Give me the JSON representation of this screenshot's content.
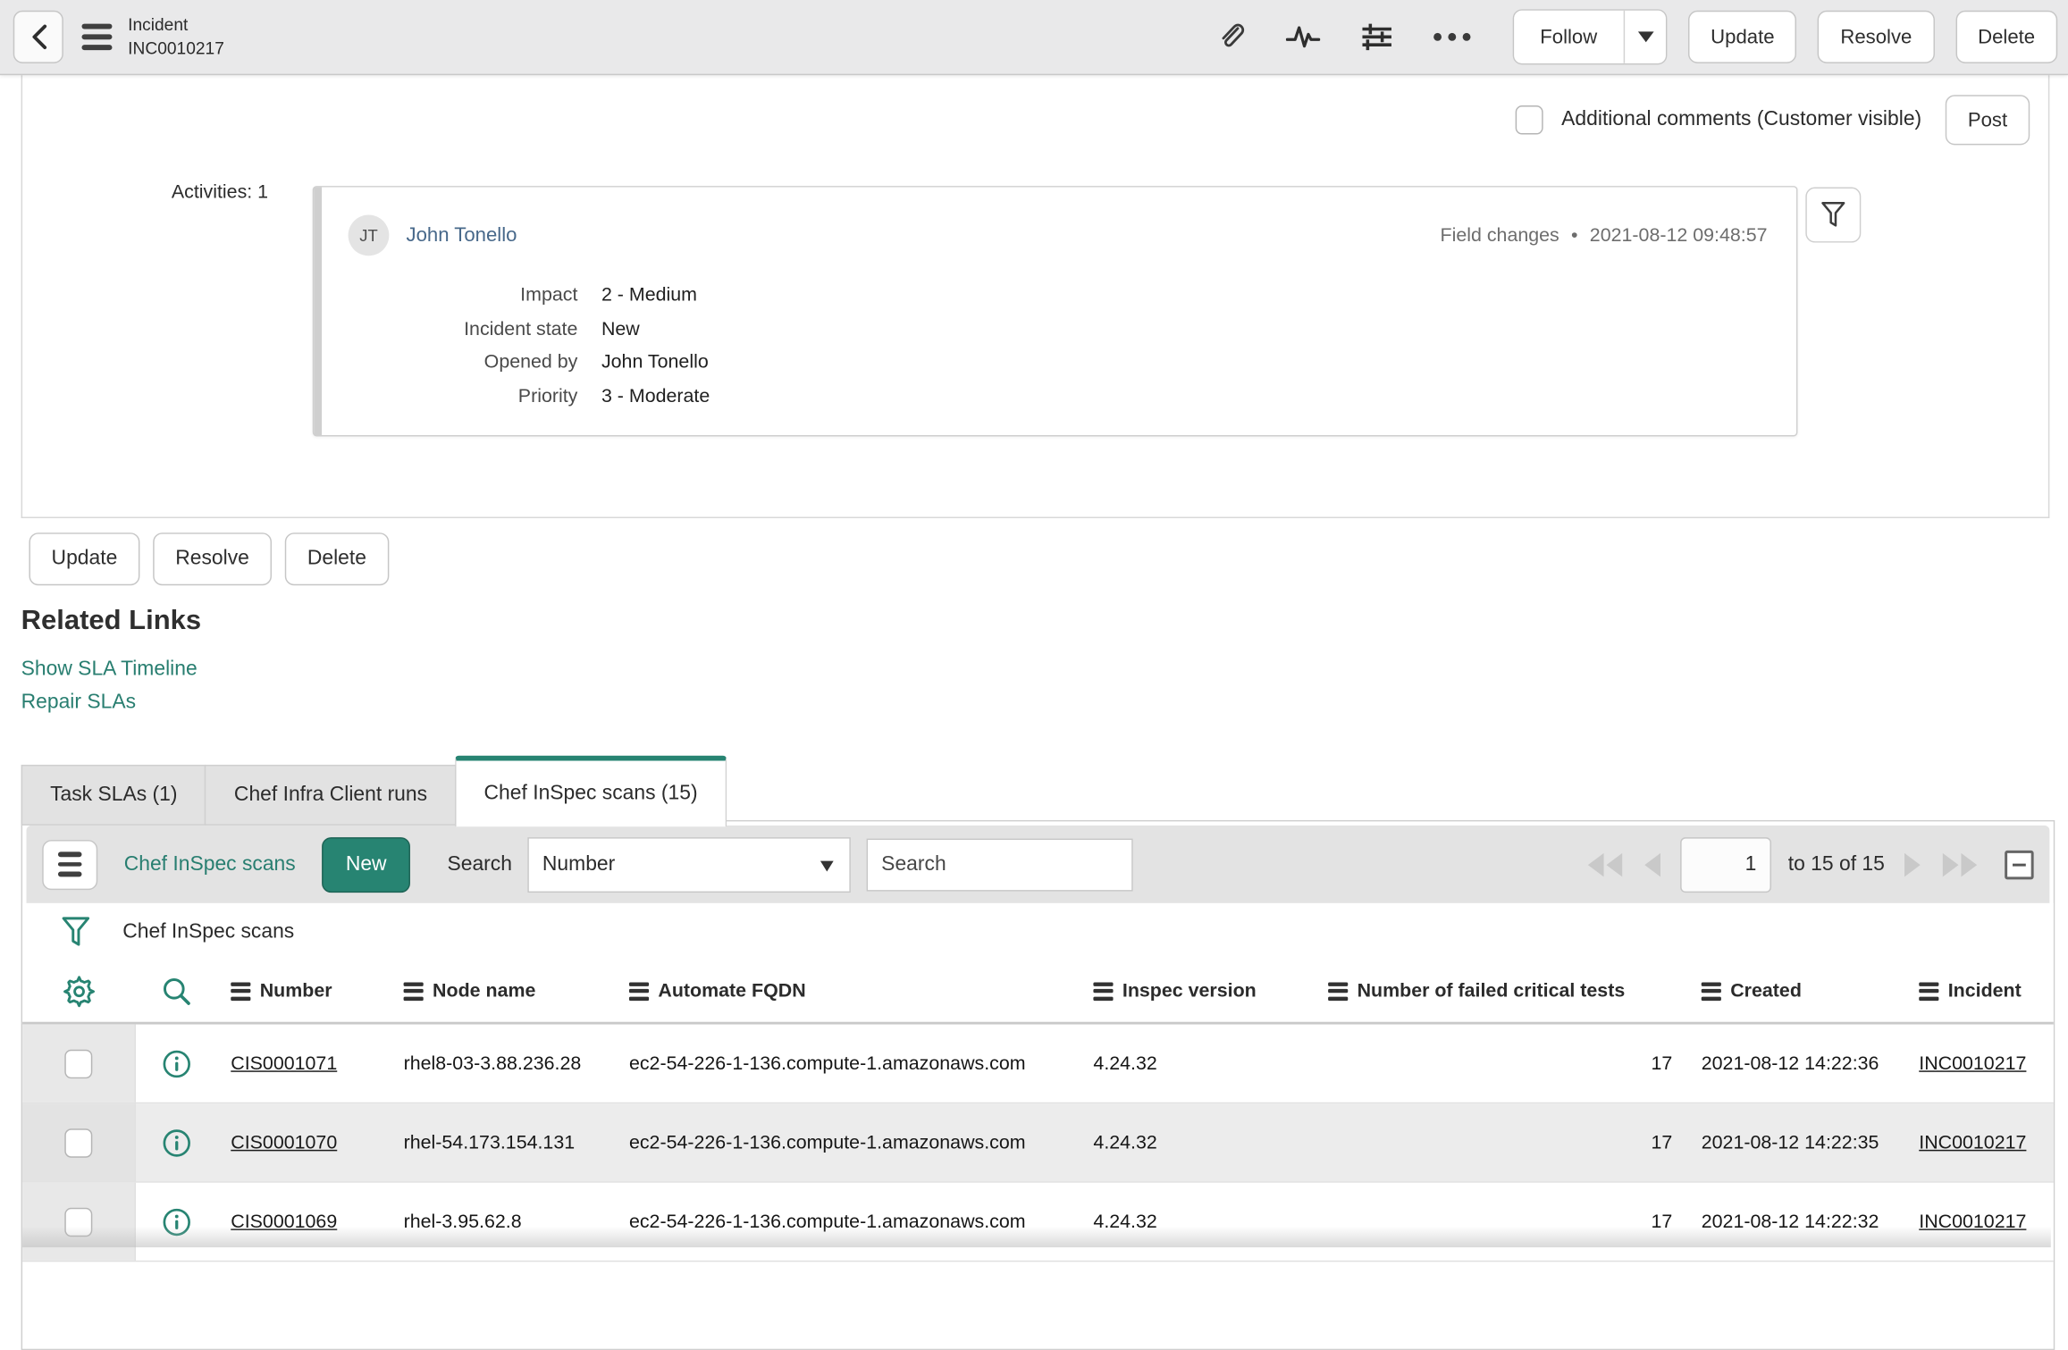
{
  "header": {
    "title": "Incident",
    "subtitle": "INC0010217",
    "follow_label": "Follow",
    "update_label": "Update",
    "resolve_label": "Resolve",
    "delete_label": "Delete"
  },
  "comments": {
    "label": "Additional comments (Customer visible)",
    "post_label": "Post"
  },
  "activities": {
    "count_label": "Activities: 1",
    "entry": {
      "avatar_initials": "JT",
      "author": "John Tonello",
      "type": "Field changes",
      "bullet": "•",
      "timestamp": "2021-08-12 09:48:57",
      "fields": [
        {
          "label": "Impact",
          "value": "2 - Medium"
        },
        {
          "label": "Incident state",
          "value": "New"
        },
        {
          "label": "Opened by",
          "value": "John Tonello"
        },
        {
          "label": "Priority",
          "value": "3 - Moderate"
        }
      ]
    }
  },
  "form_actions": {
    "update_label": "Update",
    "resolve_label": "Resolve",
    "delete_label": "Delete"
  },
  "related_links": {
    "heading": "Related Links",
    "show_sla_timeline": "Show SLA Timeline",
    "repair_slas": "Repair SLAs"
  },
  "tabs": [
    {
      "label": "Task SLAs (1)"
    },
    {
      "label": "Chef Infra Client runs"
    },
    {
      "label": "Chef InSpec scans (15)"
    }
  ],
  "list": {
    "title": "Chef InSpec scans",
    "new_label": "New",
    "search_label": "Search",
    "search_field_selected": "Number",
    "search_placeholder": "Search",
    "breadcrumb": "Chef InSpec scans",
    "pagination": {
      "current_page": "1",
      "range_label": "to 15 of 15"
    },
    "columns": {
      "number": "Number",
      "node_name": "Node name",
      "automate_fqdn": "Automate FQDN",
      "inspec_version": "Inspec version",
      "failed_tests": "Number of failed critical tests",
      "created": "Created",
      "incident": "Incident"
    },
    "rows": [
      {
        "number": "CIS0001071",
        "node_name": "rhel8-03-3.88.236.28",
        "automate_fqdn": "ec2-54-226-1-136.compute-1.amazonaws.com",
        "inspec_version": "4.24.32",
        "failed_tests": "17",
        "created": "2021-08-12 14:22:36",
        "incident": "INC0010217"
      },
      {
        "number": "CIS0001070",
        "node_name": "rhel-54.173.154.131",
        "automate_fqdn": "ec2-54-226-1-136.compute-1.amazonaws.com",
        "inspec_version": "4.24.32",
        "failed_tests": "17",
        "created": "2021-08-12 14:22:35",
        "incident": "INC0010217"
      },
      {
        "number": "CIS0001069",
        "node_name": "rhel-3.95.62.8",
        "automate_fqdn": "ec2-54-226-1-136.compute-1.amazonaws.com",
        "inspec_version": "4.24.32",
        "failed_tests": "17",
        "created": "2021-08-12 14:22:32",
        "incident": "INC0010217"
      }
    ]
  },
  "colors": {
    "accent_teal": "#278472",
    "link_teal": "#287e70",
    "header_bg": "#e9e9ea",
    "row_alt_bg": "#ececec"
  }
}
